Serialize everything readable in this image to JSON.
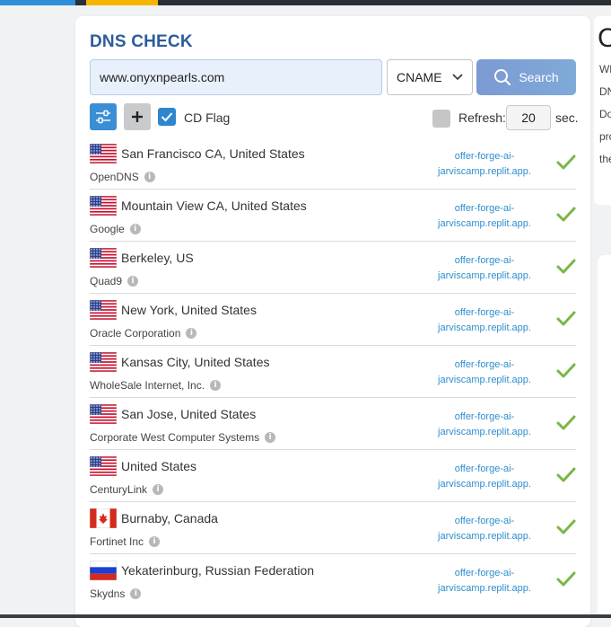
{
  "card": {
    "title": "DNS CHECK",
    "domain_value": "www.onyxnpearls.com",
    "record_type": "CNAME",
    "search_label": "Search",
    "cd_flag_label": "CD Flag",
    "refresh_label": "Refresh:",
    "refresh_value": "20",
    "refresh_unit": "sec."
  },
  "results": [
    {
      "country": "us",
      "location": "San Francisco CA, United States",
      "provider": "OpenDNS",
      "value_line1": "offer-forge-ai-",
      "value_line2": "jarviscamp.replit.app."
    },
    {
      "country": "us",
      "location": "Mountain View CA, United States",
      "provider": "Google",
      "value_line1": "offer-forge-ai-",
      "value_line2": "jarviscamp.replit.app."
    },
    {
      "country": "us",
      "location": "Berkeley, US",
      "provider": "Quad9",
      "value_line1": "offer-forge-ai-",
      "value_line2": "jarviscamp.replit.app."
    },
    {
      "country": "us",
      "location": "New York, United States",
      "provider": "Oracle Corporation",
      "value_line1": "offer-forge-ai-",
      "value_line2": "jarviscamp.replit.app."
    },
    {
      "country": "us",
      "location": "Kansas City, United States",
      "provider": "WholeSale Internet, Inc.",
      "value_line1": "offer-forge-ai-",
      "value_line2": "jarviscamp.replit.app."
    },
    {
      "country": "us",
      "location": "San Jose, United States",
      "provider": "Corporate West Computer Systems",
      "value_line1": "offer-forge-ai-",
      "value_line2": "jarviscamp.replit.app."
    },
    {
      "country": "us",
      "location": "United States",
      "provider": "CenturyLink",
      "value_line1": "offer-forge-ai-",
      "value_line2": "jarviscamp.replit.app."
    },
    {
      "country": "ca",
      "location": "Burnaby, Canada",
      "provider": "Fortinet Inc",
      "value_line1": "offer-forge-ai-",
      "value_line2": "jarviscamp.replit.app."
    },
    {
      "country": "ru",
      "location": "Yekaterinburg, Russian Federation",
      "provider": "Skydns",
      "value_line1": "offer-forge-ai-",
      "value_line2": "jarviscamp.replit.app."
    }
  ],
  "side": {
    "heading": "C",
    "lines": [
      "Wh",
      "DN",
      "Do",
      "pro",
      "the"
    ]
  },
  "colors": {
    "accent": "#2c5c9c",
    "link": "#2e8ece",
    "ok": "#7ab648"
  }
}
